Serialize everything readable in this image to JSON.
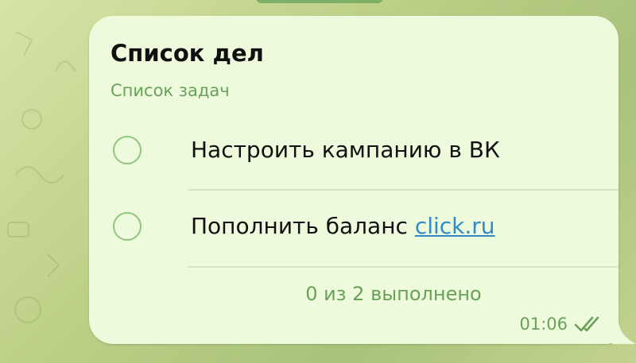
{
  "checklist": {
    "title": "Список дел",
    "subtitle": "Список задач",
    "tasks": [
      {
        "text": "Настроить кампанию в ВК",
        "done": false
      },
      {
        "text_prefix": "Пополнить баланс ",
        "link": "click.ru",
        "done": false
      }
    ],
    "progress_text": "0 из 2 выполнено"
  },
  "message": {
    "time": "01:06",
    "status_icon": "double-check-icon"
  },
  "colors": {
    "bubble": "#eefadc",
    "accent_green": "#6aa15a",
    "radio_border": "#8fc47e",
    "link": "#2f8bc6"
  }
}
